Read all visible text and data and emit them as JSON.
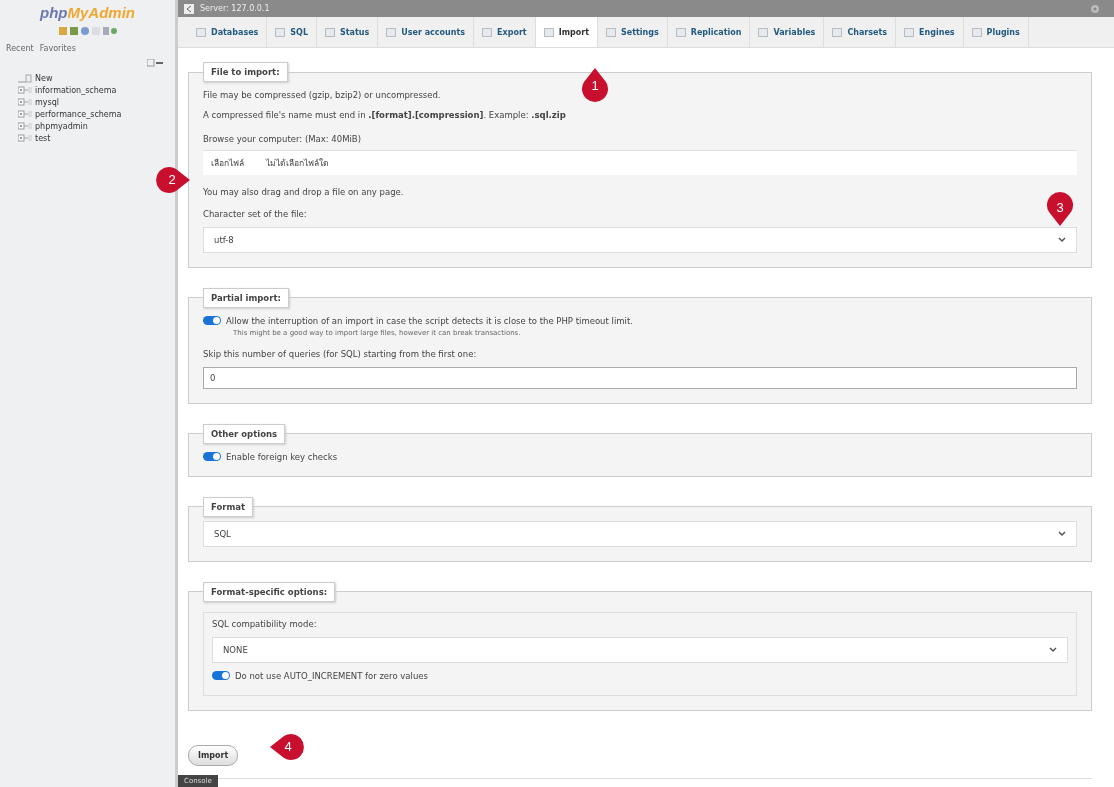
{
  "sidebar": {
    "logo": {
      "prefix": "php",
      "suffix": "MyAdmin"
    },
    "tabs": [
      {
        "label": "Recent",
        "selected": false
      },
      {
        "label": "Favorites",
        "selected": false
      }
    ],
    "tree": [
      {
        "kind": "new",
        "label": "New"
      },
      {
        "kind": "database",
        "label": "information_schema"
      },
      {
        "kind": "database",
        "label": "mysql"
      },
      {
        "kind": "database",
        "label": "performance_schema"
      },
      {
        "kind": "database",
        "label": "phpmyadmin"
      },
      {
        "kind": "database",
        "label": "test"
      }
    ]
  },
  "window": {
    "title": "Server: 127.0.0.1"
  },
  "tabs": [
    {
      "label": "Databases",
      "selected": false
    },
    {
      "label": "SQL",
      "selected": false
    },
    {
      "label": "Status",
      "selected": false
    },
    {
      "label": "User accounts",
      "selected": false
    },
    {
      "label": "Export",
      "selected": false
    },
    {
      "label": "Import",
      "selected": true
    },
    {
      "label": "Settings",
      "selected": false
    },
    {
      "label": "Replication",
      "selected": false
    },
    {
      "label": "Variables",
      "selected": false
    },
    {
      "label": "Charsets",
      "selected": false
    },
    {
      "label": "Engines",
      "selected": false
    },
    {
      "label": "Plugins",
      "selected": false
    }
  ],
  "sections": [
    {
      "legend": "File to import:",
      "items": [
        {
          "kind": "text",
          "text": "File may be compressed (gzip, bzip2) or uncompressed."
        },
        {
          "kind": "text",
          "text": "A compressed file's name must end in **.[format].[compression]**. Example: **.sql.zip**"
        },
        {
          "kind": "label",
          "text": "Browse your computer: (Max: 40MiB)"
        },
        {
          "kind": "file",
          "button": "เลือกไฟล์",
          "value": "ไม่ได้เลือกไฟล์ใด"
        },
        {
          "kind": "label",
          "text": "You may also drag and drop a file on any page."
        },
        {
          "kind": "label",
          "text": "Character set of the file:"
        },
        {
          "kind": "select",
          "value": "utf-8"
        }
      ]
    },
    {
      "legend": "Partial import:",
      "items": [
        {
          "kind": "toggle",
          "text": "Allow the interruption of an import in case the script detects it is close to the PHP timeout limit.",
          "note": "This might be a good way to import large files, however it can break transactions.",
          "on": true
        },
        {
          "kind": "label",
          "text": "Skip this number of queries (for SQL) starting from the first one:"
        },
        {
          "kind": "input",
          "value": "0"
        }
      ]
    },
    {
      "legend": "Other options",
      "items": [
        {
          "kind": "toggle",
          "text": "Enable foreign key checks",
          "on": true
        }
      ]
    },
    {
      "legend": "Format",
      "items": [
        {
          "kind": "select",
          "value": "SQL"
        }
      ]
    },
    {
      "legend": "Format-specific options:",
      "items": [
        {
          "kind": "group",
          "items": [
            {
              "kind": "label",
              "text": "SQL compatibility mode:"
            },
            {
              "kind": "select",
              "value": "NONE"
            },
            {
              "kind": "toggle",
              "text": "Do not use AUTO_INCREMENT for zero values",
              "on": true
            }
          ]
        }
      ]
    }
  ],
  "submit": "Import",
  "console": "Console",
  "markers": [
    {
      "number": "1",
      "kind": "up"
    },
    {
      "number": "2",
      "kind": "right"
    },
    {
      "number": "3",
      "kind": "down"
    },
    {
      "number": "4",
      "kind": "left"
    }
  ]
}
